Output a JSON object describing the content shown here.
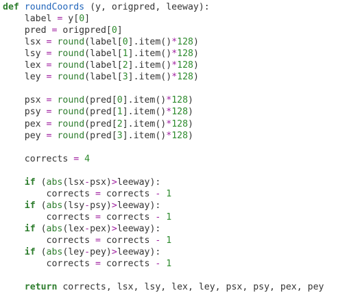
{
  "code_lines": [
    [
      [
        "kw",
        "def"
      ],
      [
        "plain",
        " "
      ],
      [
        "fn",
        "roundCoords"
      ],
      [
        "plain",
        " (y, origpred, leeway):"
      ]
    ],
    [
      [
        "plain",
        "    label "
      ],
      [
        "op",
        "="
      ],
      [
        "plain",
        " y["
      ],
      [
        "num",
        "0"
      ],
      [
        "plain",
        "]"
      ]
    ],
    [
      [
        "plain",
        "    pred "
      ],
      [
        "op",
        "="
      ],
      [
        "plain",
        " origpred["
      ],
      [
        "num",
        "0"
      ],
      [
        "plain",
        "]"
      ]
    ],
    [
      [
        "plain",
        "    lsx "
      ],
      [
        "op",
        "="
      ],
      [
        "plain",
        " "
      ],
      [
        "bi",
        "round"
      ],
      [
        "plain",
        "(label["
      ],
      [
        "num",
        "0"
      ],
      [
        "plain",
        "].item()"
      ],
      [
        "op",
        "*"
      ],
      [
        "num",
        "128"
      ],
      [
        "plain",
        ")"
      ]
    ],
    [
      [
        "plain",
        "    lsy "
      ],
      [
        "op",
        "="
      ],
      [
        "plain",
        " "
      ],
      [
        "bi",
        "round"
      ],
      [
        "plain",
        "(label["
      ],
      [
        "num",
        "1"
      ],
      [
        "plain",
        "].item()"
      ],
      [
        "op",
        "*"
      ],
      [
        "num",
        "128"
      ],
      [
        "plain",
        ")"
      ]
    ],
    [
      [
        "plain",
        "    lex "
      ],
      [
        "op",
        "="
      ],
      [
        "plain",
        " "
      ],
      [
        "bi",
        "round"
      ],
      [
        "plain",
        "(label["
      ],
      [
        "num",
        "2"
      ],
      [
        "plain",
        "].item()"
      ],
      [
        "op",
        "*"
      ],
      [
        "num",
        "128"
      ],
      [
        "plain",
        ")"
      ]
    ],
    [
      [
        "plain",
        "    ley "
      ],
      [
        "op",
        "="
      ],
      [
        "plain",
        " "
      ],
      [
        "bi",
        "round"
      ],
      [
        "plain",
        "(label["
      ],
      [
        "num",
        "3"
      ],
      [
        "plain",
        "].item()"
      ],
      [
        "op",
        "*"
      ],
      [
        "num",
        "128"
      ],
      [
        "plain",
        ")"
      ]
    ],
    [],
    [
      [
        "plain",
        "    psx "
      ],
      [
        "op",
        "="
      ],
      [
        "plain",
        " "
      ],
      [
        "bi",
        "round"
      ],
      [
        "plain",
        "(pred["
      ],
      [
        "num",
        "0"
      ],
      [
        "plain",
        "].item()"
      ],
      [
        "op",
        "*"
      ],
      [
        "num",
        "128"
      ],
      [
        "plain",
        ")"
      ]
    ],
    [
      [
        "plain",
        "    psy "
      ],
      [
        "op",
        "="
      ],
      [
        "plain",
        " "
      ],
      [
        "bi",
        "round"
      ],
      [
        "plain",
        "(pred["
      ],
      [
        "num",
        "1"
      ],
      [
        "plain",
        "].item()"
      ],
      [
        "op",
        "*"
      ],
      [
        "num",
        "128"
      ],
      [
        "plain",
        ")"
      ]
    ],
    [
      [
        "plain",
        "    pex "
      ],
      [
        "op",
        "="
      ],
      [
        "plain",
        " "
      ],
      [
        "bi",
        "round"
      ],
      [
        "plain",
        "(pred["
      ],
      [
        "num",
        "2"
      ],
      [
        "plain",
        "].item()"
      ],
      [
        "op",
        "*"
      ],
      [
        "num",
        "128"
      ],
      [
        "plain",
        ")"
      ]
    ],
    [
      [
        "plain",
        "    pey "
      ],
      [
        "op",
        "="
      ],
      [
        "plain",
        " "
      ],
      [
        "bi",
        "round"
      ],
      [
        "plain",
        "(pred["
      ],
      [
        "num",
        "3"
      ],
      [
        "plain",
        "].item()"
      ],
      [
        "op",
        "*"
      ],
      [
        "num",
        "128"
      ],
      [
        "plain",
        ")"
      ]
    ],
    [],
    [
      [
        "plain",
        "    corrects "
      ],
      [
        "op",
        "="
      ],
      [
        "plain",
        " "
      ],
      [
        "num",
        "4"
      ]
    ],
    [],
    [
      [
        "plain",
        "    "
      ],
      [
        "kw",
        "if"
      ],
      [
        "plain",
        " ("
      ],
      [
        "bi",
        "abs"
      ],
      [
        "plain",
        "(lsx"
      ],
      [
        "op",
        "-"
      ],
      [
        "plain",
        "psx)"
      ],
      [
        "op",
        ">"
      ],
      [
        "plain",
        "leeway):"
      ]
    ],
    [
      [
        "plain",
        "        corrects "
      ],
      [
        "op",
        "="
      ],
      [
        "plain",
        " corrects "
      ],
      [
        "op",
        "-"
      ],
      [
        "plain",
        " "
      ],
      [
        "num",
        "1"
      ]
    ],
    [
      [
        "plain",
        "    "
      ],
      [
        "kw",
        "if"
      ],
      [
        "plain",
        " ("
      ],
      [
        "bi",
        "abs"
      ],
      [
        "plain",
        "(lsy"
      ],
      [
        "op",
        "-"
      ],
      [
        "plain",
        "psy)"
      ],
      [
        "op",
        ">"
      ],
      [
        "plain",
        "leeway):"
      ]
    ],
    [
      [
        "plain",
        "        corrects "
      ],
      [
        "op",
        "="
      ],
      [
        "plain",
        " corrects "
      ],
      [
        "op",
        "-"
      ],
      [
        "plain",
        " "
      ],
      [
        "num",
        "1"
      ]
    ],
    [
      [
        "plain",
        "    "
      ],
      [
        "kw",
        "if"
      ],
      [
        "plain",
        " ("
      ],
      [
        "bi",
        "abs"
      ],
      [
        "plain",
        "(lex"
      ],
      [
        "op",
        "-"
      ],
      [
        "plain",
        "pex)"
      ],
      [
        "op",
        ">"
      ],
      [
        "plain",
        "leeway):"
      ]
    ],
    [
      [
        "plain",
        "        corrects "
      ],
      [
        "op",
        "="
      ],
      [
        "plain",
        " corrects "
      ],
      [
        "op",
        "-"
      ],
      [
        "plain",
        " "
      ],
      [
        "num",
        "1"
      ]
    ],
    [
      [
        "plain",
        "    "
      ],
      [
        "kw",
        "if"
      ],
      [
        "plain",
        " ("
      ],
      [
        "bi",
        "abs"
      ],
      [
        "plain",
        "(ley"
      ],
      [
        "op",
        "-"
      ],
      [
        "plain",
        "pey)"
      ],
      [
        "op",
        ">"
      ],
      [
        "plain",
        "leeway):"
      ]
    ],
    [
      [
        "plain",
        "        corrects "
      ],
      [
        "op",
        "="
      ],
      [
        "plain",
        " corrects "
      ],
      [
        "op",
        "-"
      ],
      [
        "plain",
        " "
      ],
      [
        "num",
        "1"
      ]
    ],
    [],
    [
      [
        "plain",
        "    "
      ],
      [
        "kw",
        "return"
      ],
      [
        "plain",
        " corrects, lsx, lsy, lex, ley, psx, psy, pex, pey"
      ]
    ]
  ],
  "colors": {
    "keyword": "#2d7d2d",
    "function_name": "#2266bb",
    "builtin": "#2d7d2d",
    "operator": "#a020a0",
    "number": "#2d8a2d",
    "text": "#333333",
    "background": "#ffffff"
  }
}
